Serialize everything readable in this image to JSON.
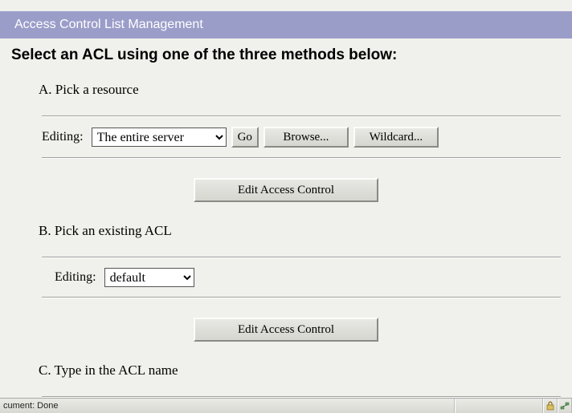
{
  "banner": {
    "title": "Access Control List Management"
  },
  "heading": "Select an ACL using one of the three methods below:",
  "sectionA": {
    "label": "A. Pick a resource",
    "editing_label": "Editing:",
    "resource_selected": "The entire server",
    "go_label": "Go",
    "browse_label": "Browse...",
    "wildcard_label": "Wildcard...",
    "edit_label": "Edit Access Control"
  },
  "sectionB": {
    "label": "B. Pick an existing ACL",
    "editing_label": "Editing:",
    "acl_selected": "default",
    "edit_label": "Edit Access Control"
  },
  "sectionC": {
    "label": "C. Type in the ACL name"
  },
  "statusbar": {
    "text": "cument: Done"
  }
}
